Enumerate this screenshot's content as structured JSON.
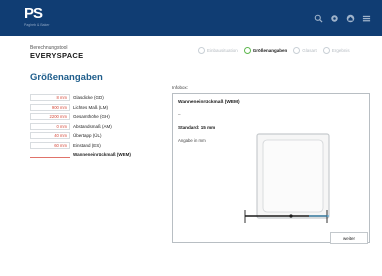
{
  "header": {
    "logo_text": "PS",
    "logo_sub": "Pagheb & Baker",
    "icons": [
      "search-icon",
      "settings-icon",
      "home-icon",
      "menu-icon"
    ]
  },
  "tool": {
    "caption": "Berechnungstool",
    "name": "EVERYSPACE"
  },
  "steps": [
    {
      "label": "Einbausituation",
      "active": false
    },
    {
      "label": "Größenangaben",
      "active": true
    },
    {
      "label": "Glasart",
      "active": false
    },
    {
      "label": "Ergebnis",
      "active": false
    }
  ],
  "section_title": "Größenangaben",
  "fields": [
    {
      "value": "8 mm",
      "label": "Glasdicke (GD)"
    },
    {
      "value": "900 mm",
      "label": "Lichtes Maß (LM)"
    },
    {
      "value": "2200 mm",
      "label": "Gesamthöhe (GH)"
    },
    {
      "value": "0 mm",
      "label": "Abstandsmaß (AM)"
    },
    {
      "value": "40 mm",
      "label": "Übertapp (ÜL)"
    },
    {
      "value": "60 mm",
      "label": "Einstand (ES)"
    },
    {
      "value": "",
      "label": "Wanneneinrückmaß (WEM)"
    }
  ],
  "infobox": {
    "caption": "Infobox:",
    "title": "Wanneneinrückmaß (WEM)",
    "dash": "–",
    "standard": "Standard: 15 mm",
    "unit": "Angabe in mm"
  },
  "next_label": "weiter",
  "colors": {
    "header_bg": "#103d73",
    "section_title": "#1f5e8c",
    "active_step": "#5fb84f",
    "input_value": "#d64a3a",
    "diagram_accent": "#3aa0d8"
  }
}
